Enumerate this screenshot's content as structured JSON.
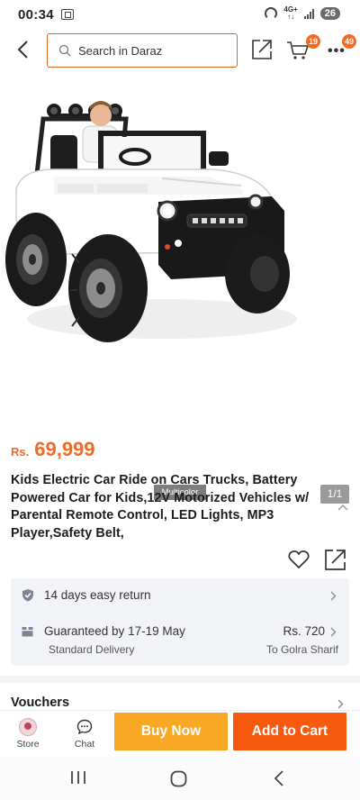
{
  "status_bar": {
    "time": "00:34",
    "network_top": "4G+",
    "network_bottom": "↑↓",
    "battery": "26"
  },
  "header": {
    "search_placeholder": "Search in Daraz",
    "cart_count": "19",
    "more_count": "49"
  },
  "gallery": {
    "variant_label": "Multicolor",
    "image_counter": "1/1"
  },
  "product": {
    "currency": "Rs.",
    "price": "69,999",
    "title": "Kids Electric Car Ride on Cars Trucks, Battery Powered Car for Kids,12V Motorized Vehicles w/ Parental Remote Control, LED Lights, MP3 Player,Safety Belt,"
  },
  "delivery": {
    "return_text": "14 days easy return",
    "guarantee_text": "Guaranteed by 17-19 May",
    "delivery_price": "Rs. 720",
    "delivery_type": "Standard Delivery",
    "location": "To Golra Sharif"
  },
  "vouchers": {
    "label": "Vouchers"
  },
  "bottom_bar": {
    "store_label": "Store",
    "chat_label": "Chat",
    "buy_now_label": "Buy Now",
    "add_to_cart_label": "Add to Cart"
  },
  "colors": {
    "accent": "#f36a25",
    "buy_now": "#f9a825",
    "add_to_cart": "#f75a0f",
    "card_background": "#f2f3f7"
  },
  "icons": [
    "back-icon",
    "search-icon",
    "share-icon",
    "cart-icon",
    "more-icon",
    "collapse-icon",
    "wishlist-icon",
    "shield-icon",
    "delivery-icon",
    "chevron-right-icon",
    "store-avatar",
    "chat-icon",
    "nav-recents-icon",
    "nav-home-icon",
    "nav-back-icon"
  ]
}
